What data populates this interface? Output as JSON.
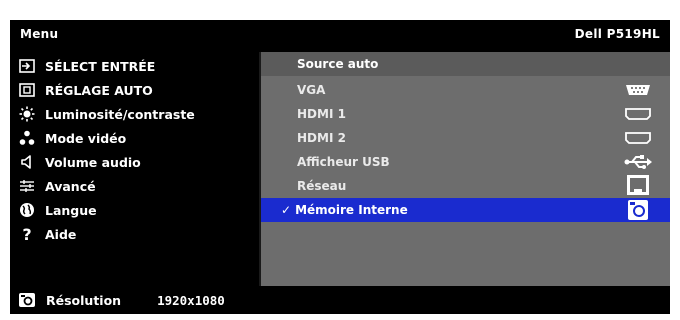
{
  "header": {
    "menu_title": "Menu",
    "model": "Dell P519HL"
  },
  "left_menu": [
    {
      "label": "SÉLECT ENTRÉE",
      "icon": "input-icon"
    },
    {
      "label": "RÉGLAGE AUTO",
      "icon": "auto-adjust-icon"
    },
    {
      "label": "Luminosité/contraste",
      "icon": "brightness-icon"
    },
    {
      "label": "Mode vidéo",
      "icon": "video-mode-icon"
    },
    {
      "label": "Volume audio",
      "icon": "speaker-icon"
    },
    {
      "label": "Avancé",
      "icon": "advanced-settings-icon"
    },
    {
      "label": "Langue",
      "icon": "globe-icon"
    },
    {
      "label": "Aide",
      "icon": "help-icon"
    }
  ],
  "right_options": [
    {
      "label": "Source auto",
      "icon": ""
    },
    {
      "label": "VGA",
      "icon": "vga-port-icon"
    },
    {
      "label": "HDMI 1",
      "icon": "hdmi-port-icon"
    },
    {
      "label": "HDMI 2",
      "icon": "hdmi-port-icon"
    },
    {
      "label": "Afficheur USB",
      "icon": "usb-icon"
    },
    {
      "label": "Réseau",
      "icon": "network-icon"
    },
    {
      "label": "Mémoire Interne",
      "icon": "internal-memory-icon",
      "check": "✓"
    }
  ],
  "footer": {
    "label": "Résolution",
    "value": "1920x1080"
  },
  "colors": {
    "highlight": "#1a2bcf",
    "panel": "#6d6d6d",
    "background": "#000000"
  }
}
